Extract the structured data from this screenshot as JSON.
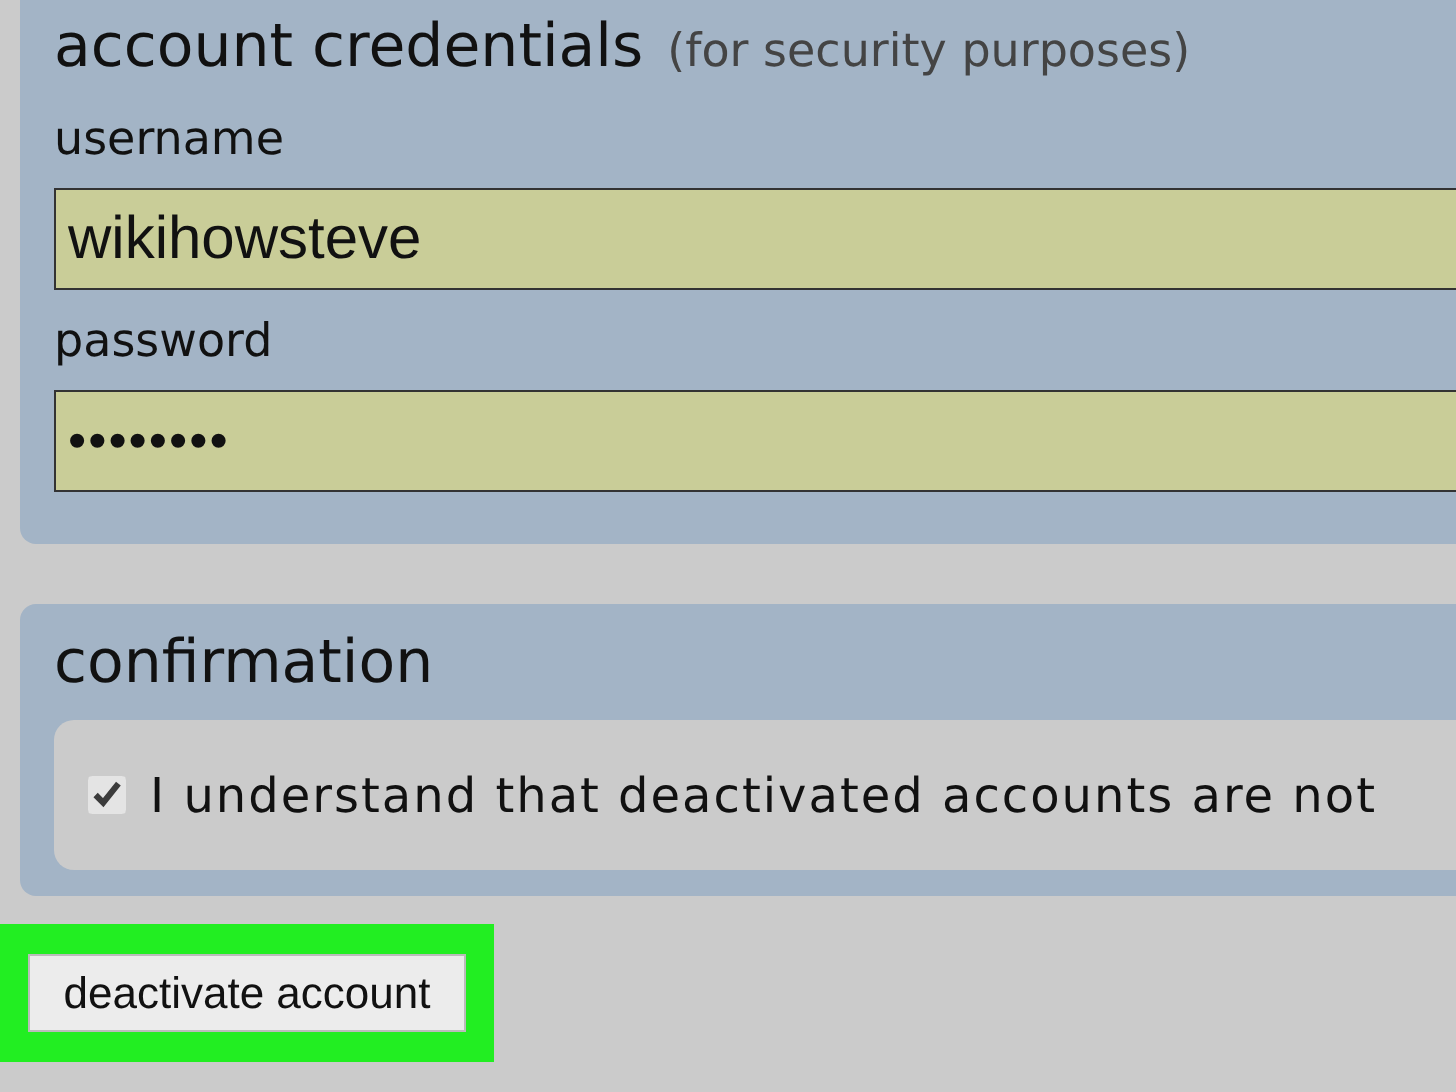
{
  "credentials": {
    "title": "account credentials",
    "subtitle": "(for security purposes)",
    "fields": [
      {
        "label": "username",
        "value": "wikihowsteve",
        "kind": "text"
      },
      {
        "label": "password",
        "value": "••••••••",
        "kind": "password"
      }
    ]
  },
  "confirmation": {
    "title": "confirmation",
    "checkbox": {
      "label": "I understand that deactivated accounts are not",
      "checked": true
    }
  },
  "button": {
    "label": "deactivate account",
    "highlighted": true
  }
}
